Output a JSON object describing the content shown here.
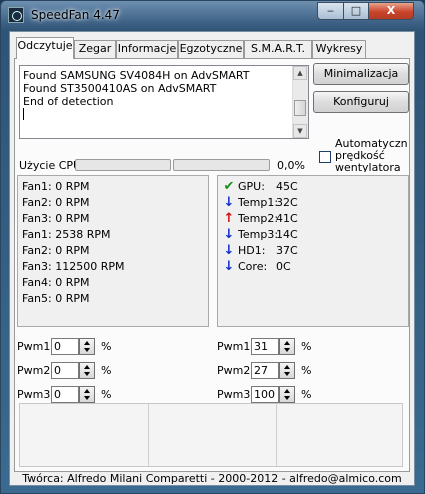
{
  "window": {
    "title": "SpeedFan 4.47",
    "minimize_glyph": "‒",
    "maximize_glyph": "□",
    "close_glyph": "X"
  },
  "tabs": [
    "Odczytuje",
    "Zegar",
    "Informacje",
    "Egzotyczne",
    "S.M.A.R.T.",
    "Wykresy"
  ],
  "log": {
    "lines": [
      "Found SAMSUNG SV4084H on AdvSMART",
      "Found ST3500410AS on AdvSMART",
      "End of detection"
    ]
  },
  "buttons": {
    "minimize": "Minimalizacja",
    "configure": "Konfiguruj"
  },
  "cpu": {
    "label": "Użycie CPU",
    "percent": "0,0%",
    "usage": 0
  },
  "auto_speed": {
    "label": "Automatyczna prędkość wentylatora",
    "checked": false
  },
  "fans": [
    "Fan1: 0 RPM",
    "Fan2: 0 RPM",
    "Fan3: 0 RPM",
    "Fan1: 2538 RPM",
    "Fan2: 0 RPM",
    "Fan3: 112500 RPM",
    "Fan4: 0 RPM",
    "Fan5: 0 RPM"
  ],
  "temps": [
    {
      "name": "GPU:",
      "value": "45C",
      "icon": "check-icon",
      "color": "#1a8f1a"
    },
    {
      "name": "Temp1:",
      "value": "32C",
      "icon": "arrow-down-icon",
      "color": "#1030c8"
    },
    {
      "name": "Temp2:",
      "value": "41C",
      "icon": "arrow-up-icon",
      "color": "#d01010"
    },
    {
      "name": "Temp3:",
      "value": "14C",
      "icon": "arrow-down-icon",
      "color": "#1030c8"
    },
    {
      "name": "HD1:",
      "value": "37C",
      "icon": "arrow-down-icon",
      "color": "#1030c8"
    },
    {
      "name": "Core:",
      "value": "0C",
      "icon": "arrow-down-icon",
      "color": "#1030c8"
    }
  ],
  "pwm_left": [
    {
      "label": "Pwm1:",
      "value": "0",
      "unit": "%"
    },
    {
      "label": "Pwm2:",
      "value": "0",
      "unit": "%"
    },
    {
      "label": "Pwm3:",
      "value": "0",
      "unit": "%"
    }
  ],
  "pwm_right": [
    {
      "label": "Pwm1:",
      "value": "31",
      "unit": "%"
    },
    {
      "label": "Pwm2:",
      "value": "27",
      "unit": "%"
    },
    {
      "label": "Pwm3:",
      "value": "100",
      "unit": "%"
    }
  ],
  "footer": "Twórca:  Alfredo Milani Comparetti - 2000-2012 - alfredo@almico.com"
}
